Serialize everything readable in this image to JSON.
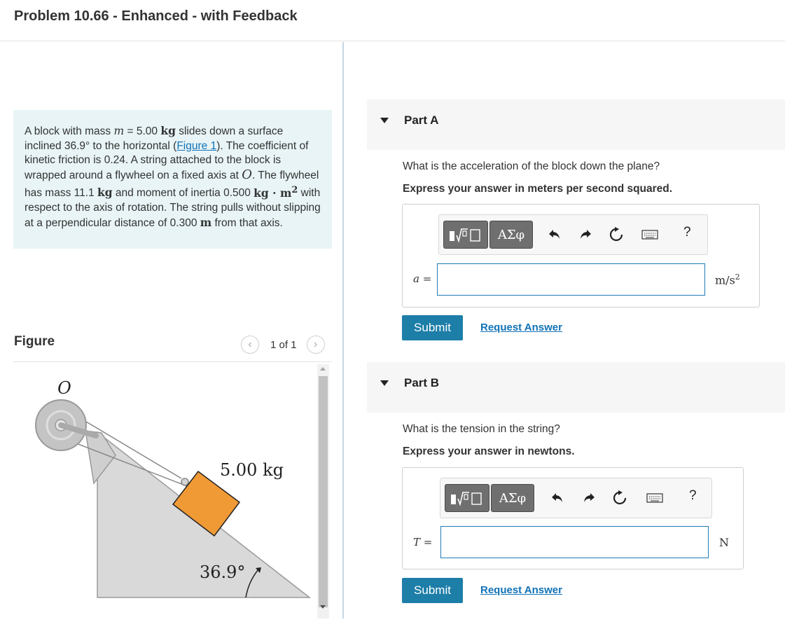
{
  "header": {
    "title": "Problem 10.66 - Enhanced - with Feedback"
  },
  "problem": {
    "t1": "A block with mass ",
    "m_var": "m",
    "t2": " = 5.00 ",
    "kg_unit": "kg",
    "t3": " slides down a surface inclined 36.9",
    "deg": "°",
    "t4": " to the horizontal (",
    "figure_link": "Figure 1",
    "t5": "). The coefficient of kinetic friction is 0.24. A string attached to the block is wrapped around a flywheel on a fixed axis at ",
    "o_var": "O",
    "t6": ". The flywheel has mass 11.1 ",
    "kg_unit2": "kg",
    "t7": " and moment of inertia 0.500 ",
    "inertia_unit": "kg · m",
    "inertia_exp": "2",
    "t8": " with respect to the axis of rotation. The string pulls without slipping at a perpendicular distance of 0.300 ",
    "m_unit": "m",
    "t9": " from that axis."
  },
  "figure": {
    "label": "Figure",
    "pager": "1 of 1",
    "prev_icon": "‹",
    "next_icon": "›",
    "axis_label": "O",
    "mass_label": "5.00 kg",
    "angle_label": "36.9°",
    "colors": {
      "block": "#f09a36",
      "incline": "#d9d9d9",
      "flywheel": "#c4c4c4"
    }
  },
  "toolbar": {
    "greek": "ΑΣφ",
    "undo_icon": "undo-icon",
    "redo_icon": "redo-icon",
    "reset_icon": "reset-icon",
    "keyboard_icon": "keyboard-icon",
    "help": "?"
  },
  "partA": {
    "title": "Part A",
    "question": "What is the acceleration of the block down the plane?",
    "instruction": "Express your answer in meters per second squared.",
    "var": "a",
    "eq": " =",
    "input_value": "",
    "unit_base": "m/s",
    "unit_exp": "2",
    "submit": "Submit",
    "request": "Request Answer"
  },
  "partB": {
    "title": "Part B",
    "question": "What is the tension in the string?",
    "instruction": "Express your answer in newtons.",
    "var": "T",
    "eq": " =",
    "input_value": "",
    "unit": "N",
    "submit": "Submit",
    "request": "Request Answer"
  },
  "colors": {
    "accent": "#1d7ea8",
    "link": "#1273b7",
    "problem_bg": "#e8f4f6"
  }
}
